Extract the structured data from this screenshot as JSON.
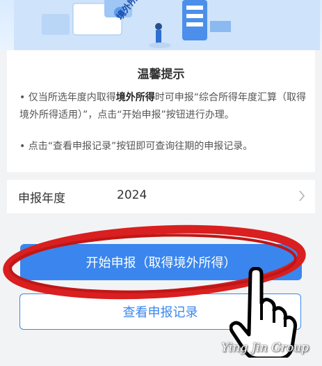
{
  "banner": {
    "text": "境外所得"
  },
  "tips": {
    "title": "温馨提示",
    "tip1_prefix": "• 仅当所选年度内取得",
    "tip1_bold": "境外所得",
    "tip1_suffix": "时可申报“综合所得年度汇算（取得境外所得适用）”，点击“开始申报”按钮进行办理。",
    "tip2": "• 点击“查看申报记录”按钮即可查询往期的申报记录。"
  },
  "year": {
    "label": "申报年度",
    "value": "2024"
  },
  "buttons": {
    "start": "开始申报（取得境外所得）",
    "records": "查看申报记录"
  },
  "watermark": "Ying Jin Group",
  "colors": {
    "primary": "#3a86ee",
    "annotation": "#d91f1f"
  }
}
